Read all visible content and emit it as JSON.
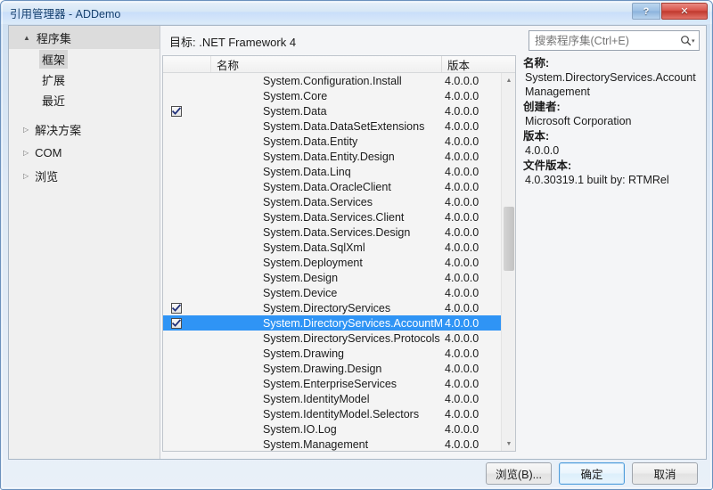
{
  "window": {
    "title": "引用管理器 - ADDemo",
    "help_label": "?",
    "close_label": "✕"
  },
  "sidebar": {
    "root": {
      "label": "程序集",
      "arrow": "▲"
    },
    "children": [
      {
        "label": "框架",
        "selected": true
      },
      {
        "label": "扩展",
        "selected": false
      },
      {
        "label": "最近",
        "selected": false
      }
    ],
    "nodes": [
      {
        "label": "解决方案",
        "arrow": "▷"
      },
      {
        "label": "COM",
        "arrow": "▷"
      },
      {
        "label": "浏览",
        "arrow": "▷"
      }
    ]
  },
  "main": {
    "target_label": "目标: .NET Framework 4",
    "search": {
      "placeholder": "搜索程序集(Ctrl+E)",
      "value": "",
      "icon": "search-icon",
      "caret": "▾"
    },
    "list": {
      "headers": {
        "check": "",
        "name": "名称",
        "version": "版本"
      },
      "rows": [
        {
          "checked": false,
          "name": "System.Configuration.Install",
          "version": "4.0.0.0",
          "selected": false
        },
        {
          "checked": false,
          "name": "System.Core",
          "version": "4.0.0.0",
          "selected": false
        },
        {
          "checked": true,
          "name": "System.Data",
          "version": "4.0.0.0",
          "selected": false
        },
        {
          "checked": false,
          "name": "System.Data.DataSetExtensions",
          "version": "4.0.0.0",
          "selected": false
        },
        {
          "checked": false,
          "name": "System.Data.Entity",
          "version": "4.0.0.0",
          "selected": false
        },
        {
          "checked": false,
          "name": "System.Data.Entity.Design",
          "version": "4.0.0.0",
          "selected": false
        },
        {
          "checked": false,
          "name": "System.Data.Linq",
          "version": "4.0.0.0",
          "selected": false
        },
        {
          "checked": false,
          "name": "System.Data.OracleClient",
          "version": "4.0.0.0",
          "selected": false
        },
        {
          "checked": false,
          "name": "System.Data.Services",
          "version": "4.0.0.0",
          "selected": false
        },
        {
          "checked": false,
          "name": "System.Data.Services.Client",
          "version": "4.0.0.0",
          "selected": false
        },
        {
          "checked": false,
          "name": "System.Data.Services.Design",
          "version": "4.0.0.0",
          "selected": false
        },
        {
          "checked": false,
          "name": "System.Data.SqlXml",
          "version": "4.0.0.0",
          "selected": false
        },
        {
          "checked": false,
          "name": "System.Deployment",
          "version": "4.0.0.0",
          "selected": false
        },
        {
          "checked": false,
          "name": "System.Design",
          "version": "4.0.0.0",
          "selected": false
        },
        {
          "checked": false,
          "name": "System.Device",
          "version": "4.0.0.0",
          "selected": false
        },
        {
          "checked": true,
          "name": "System.DirectoryServices",
          "version": "4.0.0.0",
          "selected": false
        },
        {
          "checked": true,
          "name": "System.DirectoryServices.AccountManage...",
          "version": "4.0.0.0",
          "selected": true
        },
        {
          "checked": false,
          "name": "System.DirectoryServices.Protocols",
          "version": "4.0.0.0",
          "selected": false
        },
        {
          "checked": false,
          "name": "System.Drawing",
          "version": "4.0.0.0",
          "selected": false
        },
        {
          "checked": false,
          "name": "System.Drawing.Design",
          "version": "4.0.0.0",
          "selected": false
        },
        {
          "checked": false,
          "name": "System.EnterpriseServices",
          "version": "4.0.0.0",
          "selected": false
        },
        {
          "checked": false,
          "name": "System.IdentityModel",
          "version": "4.0.0.0",
          "selected": false
        },
        {
          "checked": false,
          "name": "System.IdentityModel.Selectors",
          "version": "4.0.0.0",
          "selected": false
        },
        {
          "checked": false,
          "name": "System.IO.Log",
          "version": "4.0.0.0",
          "selected": false
        },
        {
          "checked": false,
          "name": "System.Management",
          "version": "4.0.0.0",
          "selected": false
        }
      ],
      "scrollbar": {
        "up": "▲",
        "down": "▼"
      }
    },
    "details": {
      "name_label": "名称:",
      "name_value": "System.DirectoryServices.AccountManagement",
      "creator_label": "创建者:",
      "creator_value": "Microsoft Corporation",
      "version_label": "版本:",
      "version_value": "4.0.0.0",
      "fileversion_label": "文件版本:",
      "fileversion_value": "4.0.30319.1 built by: RTMRel"
    }
  },
  "footer": {
    "browse": "浏览(B)...",
    "ok": "确定",
    "cancel": "取消"
  },
  "colors": {
    "selection": "#2f94f5",
    "title_text": "#16406e",
    "close_button": "#c0392e"
  }
}
